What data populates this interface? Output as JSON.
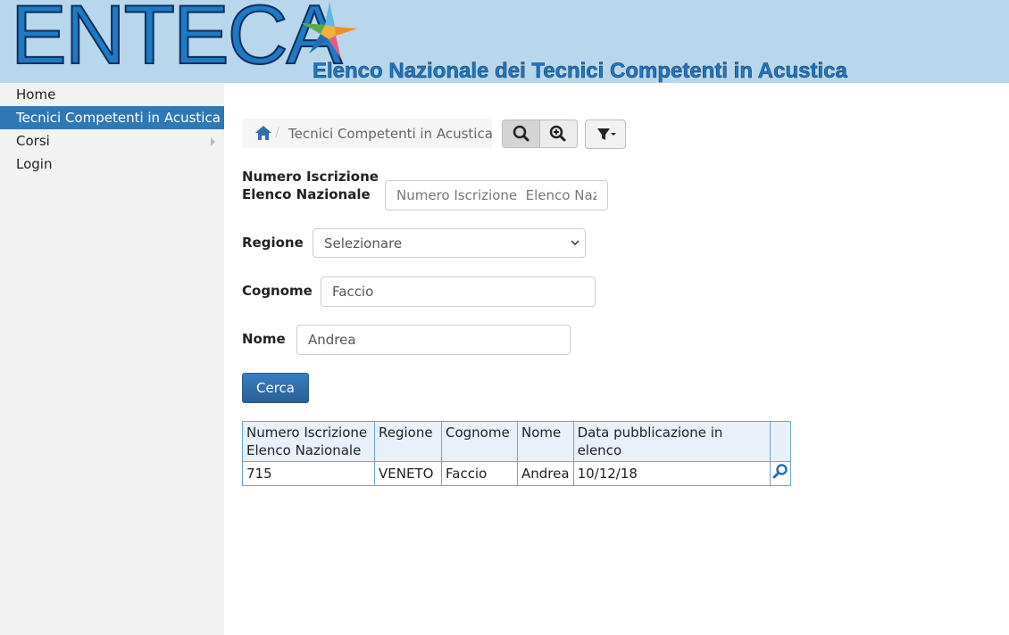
{
  "header": {
    "logo_text": "ENTECA",
    "subtitle": "Elenco Nazionale dei Tecnici Competenti in Acustica"
  },
  "sidebar": {
    "items": [
      {
        "label": "Home"
      },
      {
        "label": "Tecnici Competenti in Acustica"
      },
      {
        "label": "Corsi"
      },
      {
        "label": "Login"
      }
    ]
  },
  "breadcrumb": {
    "separator": "/",
    "current": "Tecnici Competenti in Acustica"
  },
  "toolbar": {
    "icons": [
      "search-icon",
      "zoom-in-icon",
      "filter-icon"
    ]
  },
  "form": {
    "numero": {
      "label_line1": "Numero Iscrizione",
      "label_line2": "Elenco Nazionale",
      "placeholder": "Numero Iscrizione  Elenco Nazionale",
      "value": ""
    },
    "regione": {
      "label": "Regione",
      "value": "Selezionare"
    },
    "cognome": {
      "label": "Cognome",
      "value": "Faccio"
    },
    "nome": {
      "label": "Nome",
      "value": "Andrea"
    },
    "submit_label": "Cerca"
  },
  "table": {
    "headers": [
      "Numero Iscrizione Elenco Nazionale",
      "Regione",
      "Cognome",
      "Nome",
      "Data pubblicazione in elenco",
      ""
    ],
    "rows": [
      [
        "715",
        "VENETO",
        "Faccio",
        "Andrea",
        "10/12/18"
      ]
    ]
  },
  "colors": {
    "header_bg": "#b9d7ec",
    "accent": "#2e78b7",
    "table_border": "#6fa2d6"
  }
}
